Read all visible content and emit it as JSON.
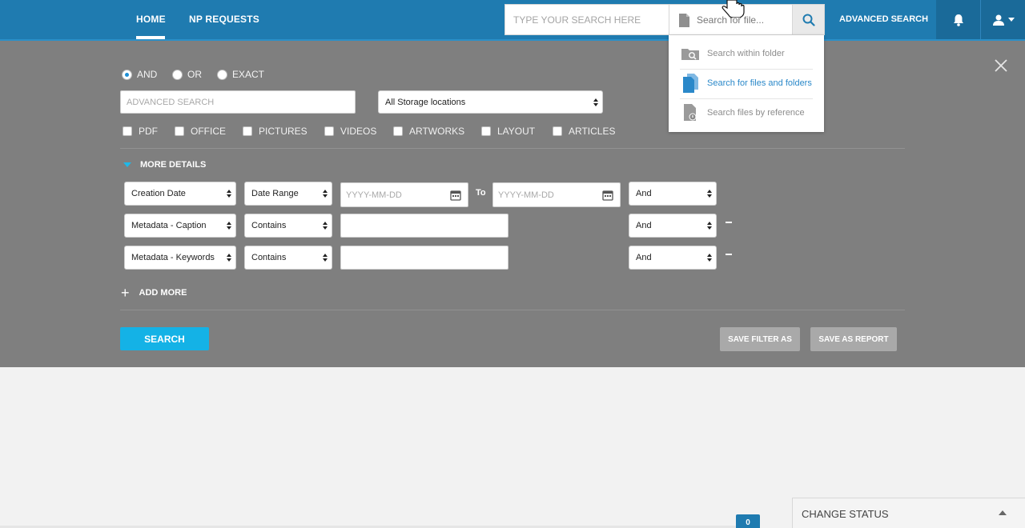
{
  "nav": {
    "home": "HOME",
    "np_requests": "NP REQUESTS"
  },
  "search": {
    "placeholder": "TYPE YOUR SEARCH HERE",
    "file_placeholder": "Search for file...",
    "advanced_link": "ADVANCED SEARCH"
  },
  "file_menu": {
    "items": [
      {
        "label": "Search within folder",
        "icon": "folder-search-icon"
      },
      {
        "label": "Search for files and folders",
        "icon": "files-icon",
        "active": true
      },
      {
        "label": "Search files by reference",
        "icon": "file-reference-icon"
      }
    ]
  },
  "advanced": {
    "match_modes": [
      "AND",
      "OR",
      "EXACT"
    ],
    "selected_mode": "AND",
    "input_placeholder": "ADVANCED SEARCH",
    "storage_location": "All Storage locations",
    "file_types": [
      "PDF",
      "OFFICE",
      "PICTURES",
      "VIDEOS",
      "ARTWORKS",
      "LAYOUT",
      "ARTICLES"
    ],
    "more_details": "MORE DETAILS",
    "rows": [
      {
        "field": "Creation Date",
        "operator": "Date Range",
        "connector": "And"
      },
      {
        "field": "Metadata - Caption",
        "operator": "Contains",
        "connector": "And"
      },
      {
        "field": "Metadata - Keywords",
        "operator": "Contains",
        "connector": "And"
      }
    ],
    "date_placeholder": "YYYY-MM-DD",
    "to_label": "To",
    "add_more": "ADD MORE",
    "search_button": "SEARCH",
    "save_filter_button": "SAVE FILTER AS",
    "save_report_button": "SAVE AS REPORT"
  },
  "footer": {
    "count": "0",
    "change_status": "CHANGE STATUS"
  },
  "colors": {
    "topbar": "#1f7bb0",
    "panel": "#7f7f7f",
    "accent": "#14b2e6",
    "active_link": "#2a88c9"
  }
}
